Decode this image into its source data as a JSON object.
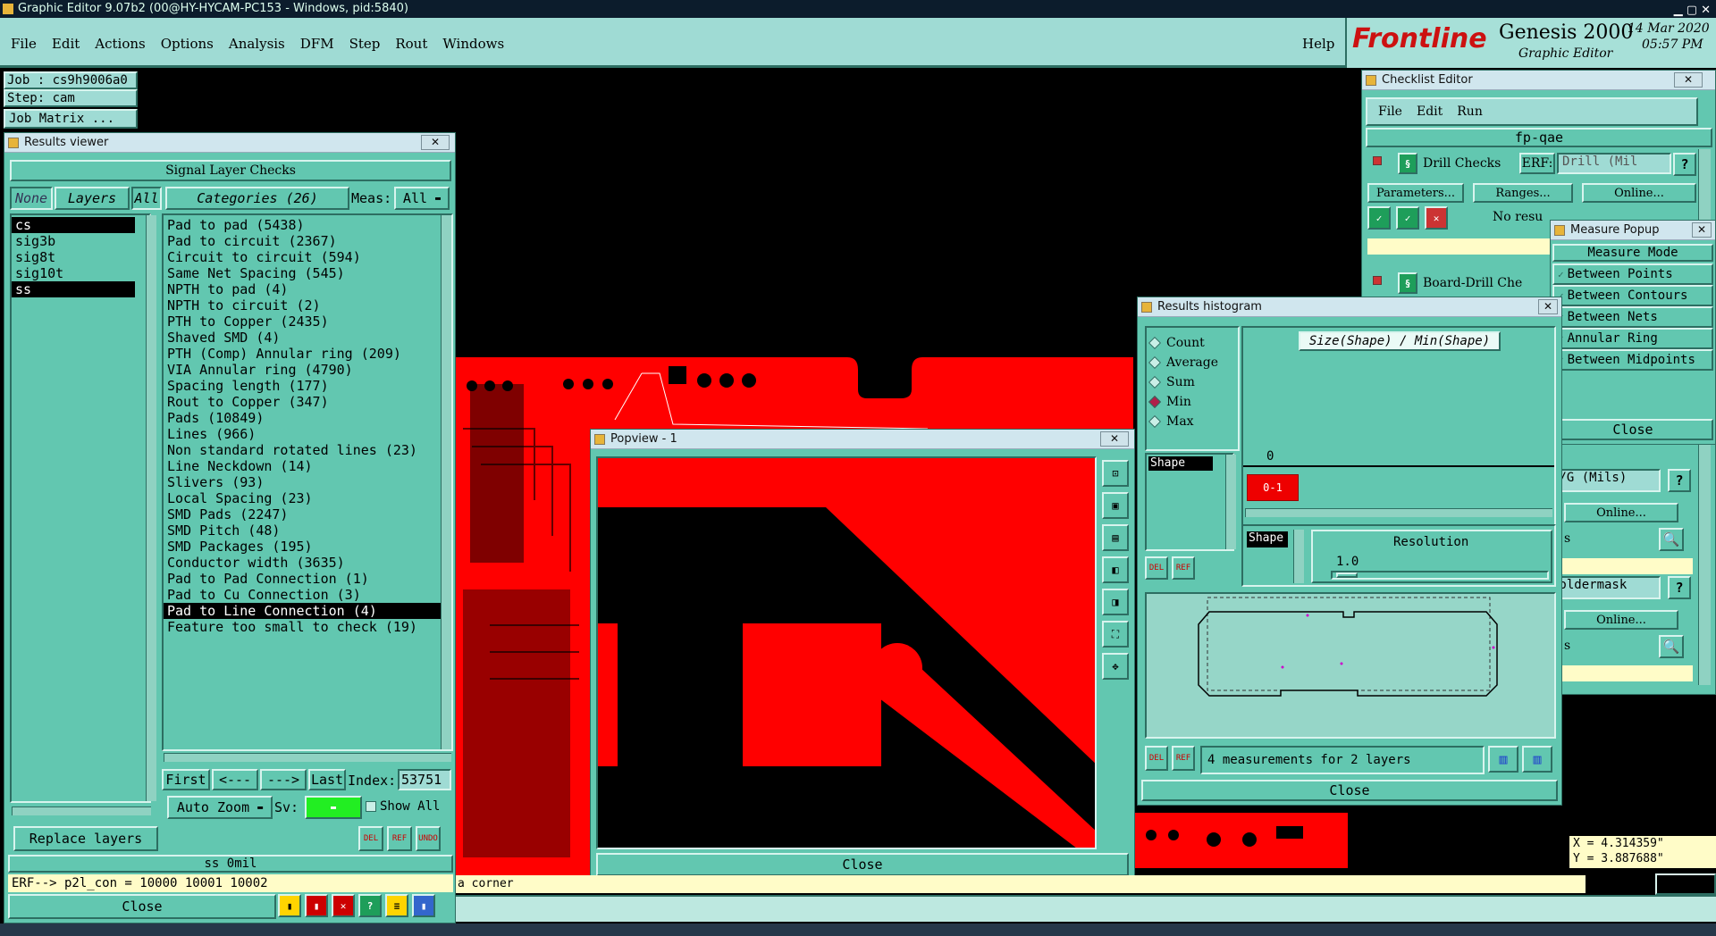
{
  "window_title": "Graphic Editor 9.07b2 (00@HY-HYCAM-PC153 - Windows, pid:5840)",
  "menu": [
    "File",
    "Edit",
    "Actions",
    "Options",
    "Analysis",
    "DFM",
    "Step",
    "Rout",
    "Windows"
  ],
  "help": "Help",
  "brand": {
    "logo": "Frontline",
    "product": "Genesis 2000",
    "sub": "Graphic Editor",
    "date": "14 Mar 2020",
    "time": "05:57 PM"
  },
  "job": {
    "job": "Job : cs9h9006a0",
    "step": "Step: cam",
    "matrix": "Job Matrix ..."
  },
  "results_viewer": {
    "title": "Results viewer",
    "header": "Signal Layer Checks",
    "none": "None",
    "layers_label": "Layers",
    "all": "All",
    "categories_label": "Categories (26)",
    "meas_label": "Meas:",
    "meas_value": "All",
    "layers": [
      "cs",
      "sig3b",
      "sig8t",
      "sig10t",
      "ss"
    ],
    "categories": [
      "Pad to pad (5438)",
      "Pad to circuit (2367)",
      "Circuit to circuit (594)",
      "Same Net Spacing (545)",
      "NPTH to pad (4)",
      "NPTH to circuit (2)",
      "PTH to Copper (2435)",
      "Shaved SMD (4)",
      "PTH (Comp) Annular ring (209)",
      "VIA Annular ring (4790)",
      "Spacing length (177)",
      "Rout to Copper (347)",
      "Pads (10849)",
      "Lines (966)",
      "Non standard rotated lines (23)",
      "Line Neckdown (14)",
      "Slivers (93)",
      "Local Spacing (23)",
      "SMD Pads (2247)",
      "SMD Pitch (48)",
      "SMD Packages (195)",
      "Conductor width (3635)",
      "Pad to Pad Connection (1)",
      "Pad to Cu Connection (3)",
      "Pad to Line Connection (4)",
      "Feature too small to check (19)"
    ],
    "first": "First",
    "prev": "<---",
    "next": "--->",
    "last": "Last",
    "index_label": "Index:",
    "index_value": "53751",
    "auto_zoom": "Auto Zoom",
    "sv": "Sv:",
    "show_all": "Show All",
    "replace_layers": "Replace layers",
    "status": "ss 0mil",
    "erf": "ERF--> p2l_con = 10000 10001 10002",
    "close": "Close",
    "del": "DEL",
    "ref": "REF",
    "undo": "UNDO"
  },
  "popview": {
    "title": "Popview - 1",
    "close": "Close"
  },
  "checklist": {
    "title": "Checklist Editor",
    "menu": [
      "File",
      "Edit",
      "Run"
    ],
    "name": "fp-qae",
    "drill_checks": "Drill Checks",
    "erf": "ERF:",
    "drill_mil": "Drill (Mil",
    "parameters": "Parameters...",
    "ranges": "Ranges...",
    "online": "Online...",
    "no_results": "No resu",
    "board_drill": "Board-Drill Che",
    "pg_mils": "P/G (Mils)",
    "soldermask": "Soldermask",
    "s": "s"
  },
  "measure": {
    "title": "Measure Popup",
    "mode": "Measure Mode",
    "options": [
      "Between Points",
      "Between Contours",
      "Between Nets",
      "Annular Ring",
      "Between Midpoints"
    ],
    "close": "Close"
  },
  "histogram": {
    "title": "Results histogram",
    "options": [
      "Count",
      "Average",
      "Sum",
      "Min",
      "Max"
    ],
    "selected": "Min",
    "shape_item": "Shape",
    "chart_title": "Size(Shape) / Min(Shape)",
    "zero": "0",
    "bin": "0-1",
    "shape_btn": "Shape",
    "resolution": "Resolution",
    "res_value": "1.0",
    "measurements": "4 measurements for 2 layers",
    "close": "Close"
  },
  "coords": {
    "x": "X = 4.314359\"",
    "y": "Y = 3.887688\""
  },
  "status_msg": "a corner",
  "units": "Inch",
  "colors": {
    "teal": "#62c7b0",
    "pcb_red": "#ff0000"
  }
}
